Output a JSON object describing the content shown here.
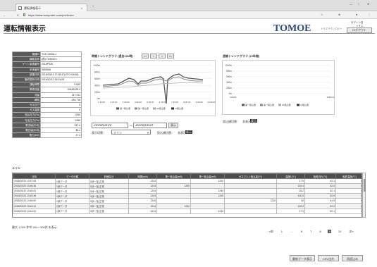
{
  "browser": {
    "tab_title": "運転情報表示",
    "url": "https://www.tomprobe.com/pro/index",
    "tab_close": "×",
    "new_tab": "+",
    "back": "←",
    "forward": "→",
    "reload": "C",
    "home": "⌂",
    "win_controls": [
      "—",
      "□",
      "✕"
    ]
  },
  "header": {
    "title": "運転情報表示",
    "logo": "TOMOE",
    "logo_tagline": "トモエテクノロジー",
    "login_label": "ログイン名",
    "login_user": "トモエ",
    "logout_button": "ログアウト"
  },
  "info_table": [
    {
      "key": "機器ID",
      "value": "TCS-1400A-1"
    },
    {
      "key": "顧客名称",
      "value": "(株) TOMOEn"
    },
    {
      "key": "ゲート製造番号",
      "value": "2016P026"
    },
    {
      "key": "本体番号",
      "value": "965Sb6t"
    },
    {
      "key": "設置日時",
      "value": "2016/03/19 17:08:47(UTC+09:00)"
    },
    {
      "key": "最終更新日時",
      "value": "2016/12/12 15:24:05"
    },
    {
      "key": "運転時間",
      "value": "9,050"
    },
    {
      "key": "累積流量",
      "value": "29445328.4"
    },
    {
      "key": "流量",
      "value": "147,911"
    },
    {
      "key": "瞬時",
      "value": "195,716"
    },
    {
      "key": "ガス圧力",
      "value": "0"
    },
    {
      "key": "ガス温度",
      "value": "0"
    },
    {
      "key": "吸込圧力(Pa)",
      "value": "1260"
    },
    {
      "key": "吐出圧力(Pa)",
      "value": "1280"
    },
    {
      "key": "電流値(平均)",
      "value": "137.4"
    },
    {
      "key": "電圧値(平均)",
      "value": "38.4"
    },
    {
      "key": "電力(kW)",
      "value": "17.4"
    }
  ],
  "chart_left": {
    "title": "時間トレンドグラフ (過去10h時)",
    "buttons": [
      "<<",
      "<",
      ">",
      ">>"
    ],
    "ylabels": [
      "1000m",
      "800m",
      "600m",
      "400m",
      "200m",
      "0m"
    ],
    "xlabels": [
      "1:30:00",
      "2:30:00",
      "3:30:00",
      "4:30:00",
      "5:30:00",
      "6:30:00",
      "7:30:00",
      "8:30:00",
      "9:30:00",
      "10:30:00"
    ],
    "legend": [
      "第一吸込量",
      "第一吸込量",
      "A1吸込量",
      "x1吸込量"
    ],
    "colors": [
      "#555555",
      "#888888",
      "#aaaaaa",
      "#333333"
    ]
  },
  "chart_right": {
    "title": "週間トレンドグラフ (10年間)",
    "ylabels": [
      "1000m",
      "800m",
      "600m",
      "400m",
      "200m",
      "0m"
    ],
    "xlabels": [
      "2016/1",
      "2016/12"
    ],
    "legend": [
      "第一吸込量",
      "第一吸込量",
      "A1吸込量",
      "x1吸込量"
    ],
    "colors": [
      "#555555",
      "#888888",
      "#aaaaaa",
      "#333333"
    ]
  },
  "filters": {
    "date_from": "2016/03/19",
    "tilde": "～",
    "date_to": "2016/03/19",
    "search_button": "表示",
    "display_label": "表示切替：",
    "display_value": "メイン",
    "left_toggle_label": "読込順切替：",
    "left_toggle_options": [
      "非表示",
      "表示"
    ],
    "right_toggle_label": "読込順切替：",
    "right_toggle_options": [
      "非表示",
      "表示"
    ]
  },
  "section_label": "メイン",
  "data_table": {
    "headers": [
      "日時",
      "データ分類",
      "詳細区分",
      "時間(min)",
      "第一吸込量(m3)",
      "第一吸込量(m3)",
      "ガスマシン吸込量(℃)",
      "温度1(℃)",
      "吸着流れ(℃)",
      "吸着温度(℃)"
    ],
    "rows": [
      [
        "2016/02/20 13:47:08",
        "1秒データ",
        "1秒一括 正常",
        "1244",
        "",
        "1240",
        "",
        "27.5",
        "62.1",
        "0"
      ],
      [
        "2016/02/20 13:46:36",
        "1秒データ",
        "1秒一括 正常",
        "1244",
        "1280",
        "",
        "",
        "126.4",
        "62.5",
        "0"
      ],
      [
        "2016/02/20 13:46:00",
        "1秒データ",
        "1秒一括 正常",
        "1244",
        "",
        "1240",
        "",
        "28.2",
        "62.1",
        "0"
      ],
      [
        "2016/02/20 13:45:36",
        "1秒データ",
        "1秒一括 正常",
        "1244",
        "",
        "1240",
        "",
        "126.5",
        "62.0",
        "0"
      ],
      [
        "2016/02/20 13:45:00",
        "1秒データ",
        "1秒一括 正常",
        "1240",
        "",
        "",
        "1225",
        "30",
        "61.9",
        "0"
      ],
      [
        "2016/02/20 13:44:31",
        "1秒データ",
        "1秒一括 正常",
        "1244",
        "1250",
        "",
        "",
        "126.2",
        "62.0",
        "0"
      ],
      [
        "2016/02/20 13:44:00",
        "1秒データ",
        "1秒一括 正常",
        "1244",
        "",
        "1240",
        "",
        "27.3",
        "62.1",
        "0"
      ]
    ]
  },
  "pagination": {
    "summary": "最大 1,000 件中 301〜300件 を表示",
    "prev": "«前",
    "pages": [
      "1",
      "…",
      "6",
      "7",
      "8",
      "9",
      "10"
    ],
    "current": "9",
    "next": "次»"
  },
  "footer_buttons": [
    "最新データ表示",
    "CSV出力",
    "再読込み"
  ]
}
